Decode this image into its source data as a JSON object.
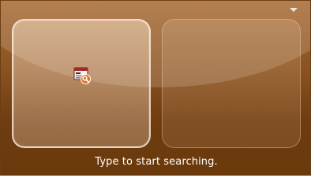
{
  "dropdown": {
    "icon": "dropdown-arrow-icon"
  },
  "tiles": [
    {
      "state": "selected",
      "icon": "search-program-icon"
    },
    {
      "state": "empty"
    }
  ],
  "status": {
    "text": "Type to start searching."
  },
  "colors": {
    "panel_top": "#a86a34",
    "panel_bottom": "#6a3a0c",
    "text": "#ffffff",
    "icon_accent": "#e8701a"
  }
}
